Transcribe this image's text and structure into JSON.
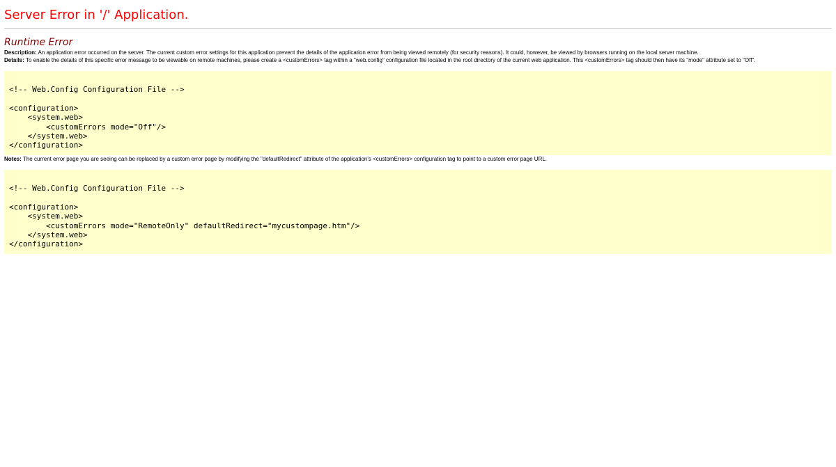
{
  "header": {
    "title": "Server Error in '/' Application."
  },
  "error": {
    "heading": "Runtime Error",
    "description_label": "Description:",
    "description_text": " An application error occurred on the server. The current custom error settings for this application prevent the details of the application error from being viewed remotely (for security reasons). It could, however, be viewed by browsers running on the local server machine.",
    "details_label": "Details:",
    "details_text": " To enable the details of this specific error message to be viewable on remote machines, please create a <customErrors> tag within a \"web.config\" configuration file located in the root directory of the current web application. This <customErrors> tag should then have its \"mode\" attribute set to \"Off\".",
    "code_sample_1": "<!-- Web.Config Configuration File -->\n\n<configuration>\n    <system.web>\n        <customErrors mode=\"Off\"/>\n    </system.web>\n</configuration>",
    "notes_label": "Notes:",
    "notes_text": " The current error page you are seeing can be replaced by a custom error page by modifying the \"defaultRedirect\" attribute of the application's <customErrors> configuration tag to point to a custom error page URL.",
    "code_sample_2": "<!-- Web.Config Configuration File -->\n\n<configuration>\n    <system.web>\n        <customErrors mode=\"RemoteOnly\" defaultRedirect=\"mycustompage.htm\"/>\n    </system.web>\n</configuration>"
  },
  "colors": {
    "title": "#ff0000",
    "heading": "#800000",
    "code_background": "#ffffcc",
    "divider": "#c0c0c0"
  }
}
